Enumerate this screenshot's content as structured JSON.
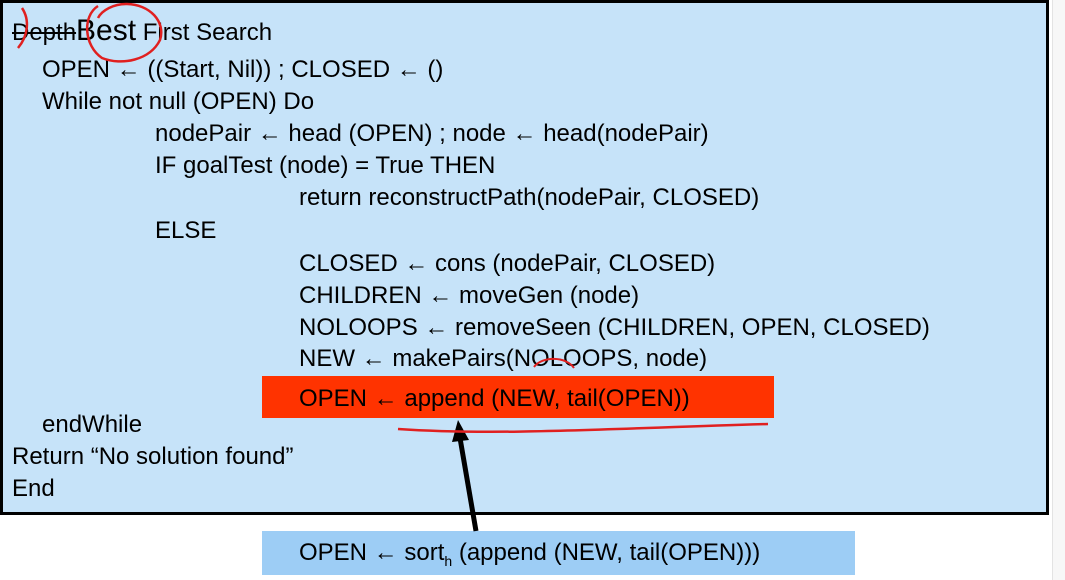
{
  "slide": {
    "title": {
      "struck": "Depth",
      "replacement": "Best",
      "rest": " First Search"
    },
    "lines": [
      "OPEN ← ((Start, Nil)) ; CLOSED ← ()",
      "While not null (OPEN) Do",
      "nodePair ← head (OPEN) ; node ← head(nodePair)",
      "IF goalTest (node) = True THEN",
      "return reconstructPath(nodePair, CLOSED)",
      "ELSE",
      "CLOSED ← cons (nodePair, CLOSED)",
      "CHILDREN ← moveGen (node)",
      "NOLOOPS ← removeSeen (CHILDREN, OPEN, CLOSED)",
      "NEW ← makePairs(NOLOOPS, node)",
      "OPEN ← append (NEW, tail(OPEN))",
      "endWhile",
      "Return “No solution found”",
      "End"
    ]
  },
  "callout": {
    "prefix": "OPEN ← sort",
    "subscript": "h",
    "suffix": " (append (NEW, tail(OPEN)))"
  },
  "colors": {
    "slide_bg": "#c6e3f9",
    "highlight": "#ff3300",
    "callout_bg": "#9dcdf5",
    "annotation_ink": "#e02020"
  }
}
